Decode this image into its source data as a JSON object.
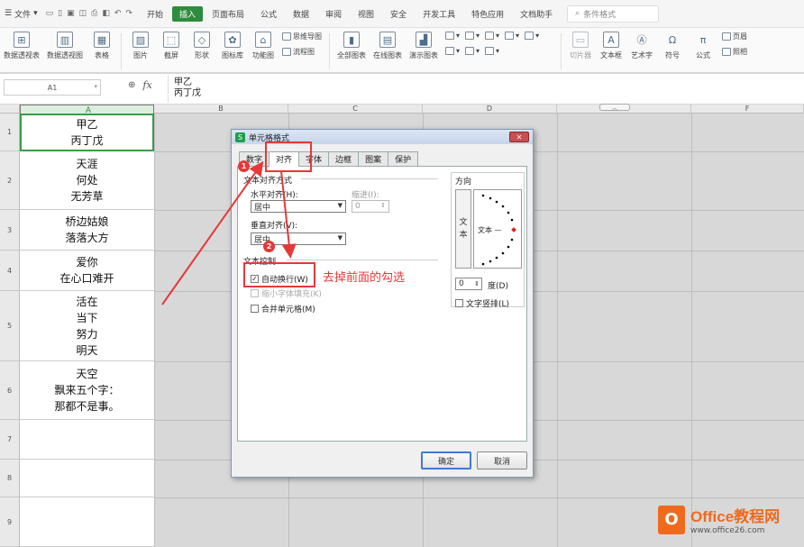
{
  "menubar": {
    "file": "文件",
    "tabs": [
      "开始",
      "插入",
      "页面布局",
      "公式",
      "数据",
      "审阅",
      "视图",
      "安全",
      "开发工具",
      "特色应用",
      "文档助手"
    ],
    "active_tab": "插入",
    "search_placeholder": "条件格式"
  },
  "ribbon": {
    "large": [
      "数据透视表",
      "数据透视图",
      "表格",
      "图片",
      "截屏",
      "形状",
      "图标库",
      "功能图"
    ],
    "small1": [
      "思维导图",
      "流程图"
    ],
    "large2": [
      "全部图表",
      "在线图表",
      "演示图表"
    ],
    "large3": [
      "切片器",
      "文本框",
      "艺术字",
      "符号",
      "公式"
    ],
    "small2": [
      "页眉",
      "照相"
    ]
  },
  "formula": {
    "namebox": "A1",
    "fx": "fx",
    "content": "甲乙\n丙丁戊"
  },
  "sheet": {
    "columns": [
      "A",
      "B",
      "C",
      "D",
      "E",
      "F"
    ],
    "rows": [
      "1",
      "2",
      "3",
      "4",
      "5",
      "6",
      "7",
      "8",
      "9"
    ],
    "cells": [
      "甲乙\n丙丁戊",
      "天涯\n何处\n无芳草",
      "桥边姑娘\n落落大方",
      "爱你\n在心口难开",
      "活在\n当下\n努力\n明天",
      "天空\n飘来五个字：\n那都不是事。",
      "",
      "",
      ""
    ]
  },
  "dialog": {
    "title": "单元格格式",
    "close": "✕",
    "tabs": [
      "数字",
      "对齐",
      "字体",
      "边框",
      "图案",
      "保护"
    ],
    "active_tab": "对齐",
    "text_align_group": "文本对齐方式",
    "h_align_label": "水平对齐(H):",
    "h_align_value": "居中",
    "indent_label": "缩进(I):",
    "indent_value": "0",
    "v_align_label": "垂直对齐(V):",
    "v_align_value": "居中",
    "text_control_group": "文本控制",
    "wrap_label": "自动换行(W)",
    "wrap_checked": true,
    "shrink_label": "缩小字体填充(K)",
    "merge_label": "合并单元格(M)",
    "direction_group": "方向",
    "direction_vertical": "文\n本",
    "direction_horizontal": "文本 —",
    "degree_value": "0",
    "degree_label": "度(D)",
    "vertical_text_label": "文字竖排(L)",
    "ok": "确定",
    "cancel": "取消"
  },
  "annotation": {
    "marker1": "1",
    "marker2": "2",
    "note": "去掉前面的勾选",
    "color": "#e63838"
  },
  "watermark": {
    "logo": "O",
    "title": "Office教程网",
    "url": "www.office26.com"
  }
}
